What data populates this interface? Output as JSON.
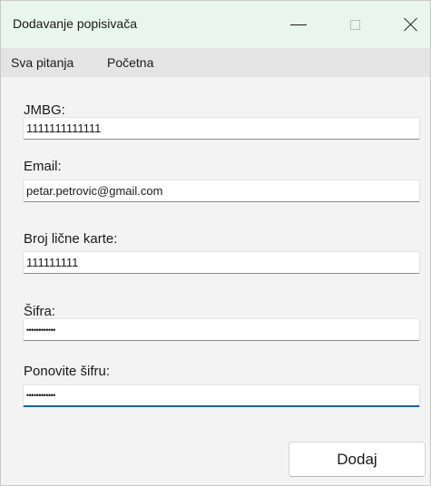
{
  "window": {
    "title": "Dodavanje popisivača"
  },
  "menu": {
    "items": [
      "Sva pitanja",
      "Početna"
    ]
  },
  "form": {
    "fields": [
      {
        "label": "JMBG:",
        "value": "1111111111111"
      },
      {
        "label": "Email:",
        "value": "petar.petrovic@gmail.com"
      },
      {
        "label": "Broj lične karte:",
        "value": "111111111"
      },
      {
        "label": "Šifra:",
        "value": "••••••••••••"
      },
      {
        "label": "Ponovite šifru:",
        "value": "••••••••••••"
      }
    ],
    "submit_label": "Dodaj"
  },
  "colors": {
    "titlebar_bg": "#e9f6ed",
    "menubar_bg": "#e4e4e4",
    "window_bg": "#f3f3f3",
    "focus_accent": "#1f5fa8"
  }
}
